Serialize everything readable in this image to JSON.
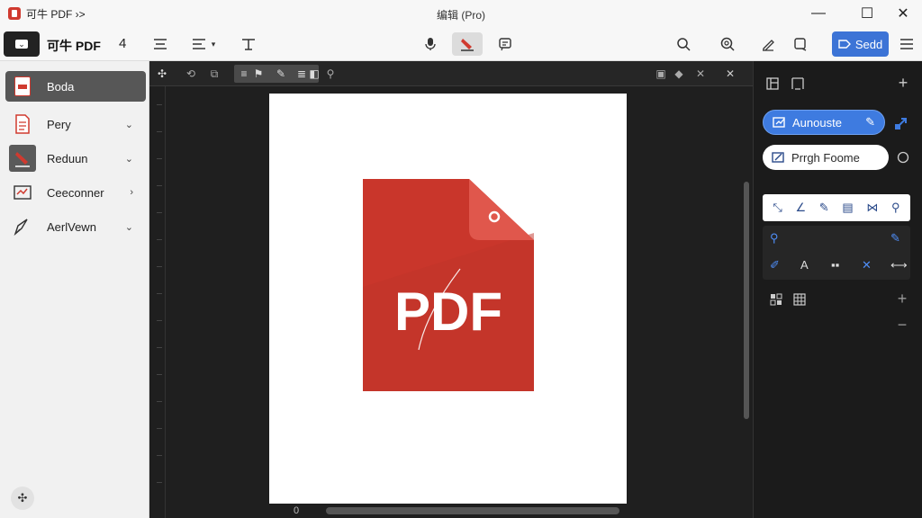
{
  "titlebar": {
    "app_title": "可牛 PDF ›>",
    "window_title": "编辑 (Pro)",
    "minimize": "—",
    "maximize": "☐",
    "close": "✕"
  },
  "toolbar": {
    "brand": "可牛 PDF",
    "page_number": "4",
    "send_label": "Sedd",
    "icons": [
      "align-icon",
      "list-icon",
      "text-align-icon",
      "mic-icon",
      "highlight-icon",
      "comment-icon",
      "search-icon",
      "search-plus-icon",
      "sign-icon",
      "share-icon"
    ]
  },
  "sidebar": {
    "items": [
      {
        "label": "Boda",
        "icon": "pdf-doc-icon",
        "chevron": ""
      },
      {
        "label": "Pery",
        "icon": "document-icon",
        "chevron": "⌄"
      },
      {
        "label": "Reduun",
        "icon": "highlighter-icon",
        "chevron": "⌄"
      },
      {
        "label": "Ceeconner",
        "icon": "image-edit-icon",
        "chevron": "›"
      },
      {
        "label": "AerlVewn",
        "icon": "pen-sign-icon",
        "chevron": "⌄"
      }
    ],
    "bottom_icon": "settings-icon"
  },
  "canvas": {
    "pdf_label": "PDF",
    "hscroll_label": "0",
    "close_glyph": "✕"
  },
  "rpanel": {
    "pill_primary": "Aunouste",
    "pill_secondary": "Prrgh Foome",
    "add_glyph": "+",
    "minus_glyph": "−"
  },
  "colors": {
    "accent": "#3c74d6",
    "pdf_red": "#d03a2f",
    "canvas_bg": "#1f1f1f",
    "panel_bg": "#1b1b1b"
  }
}
